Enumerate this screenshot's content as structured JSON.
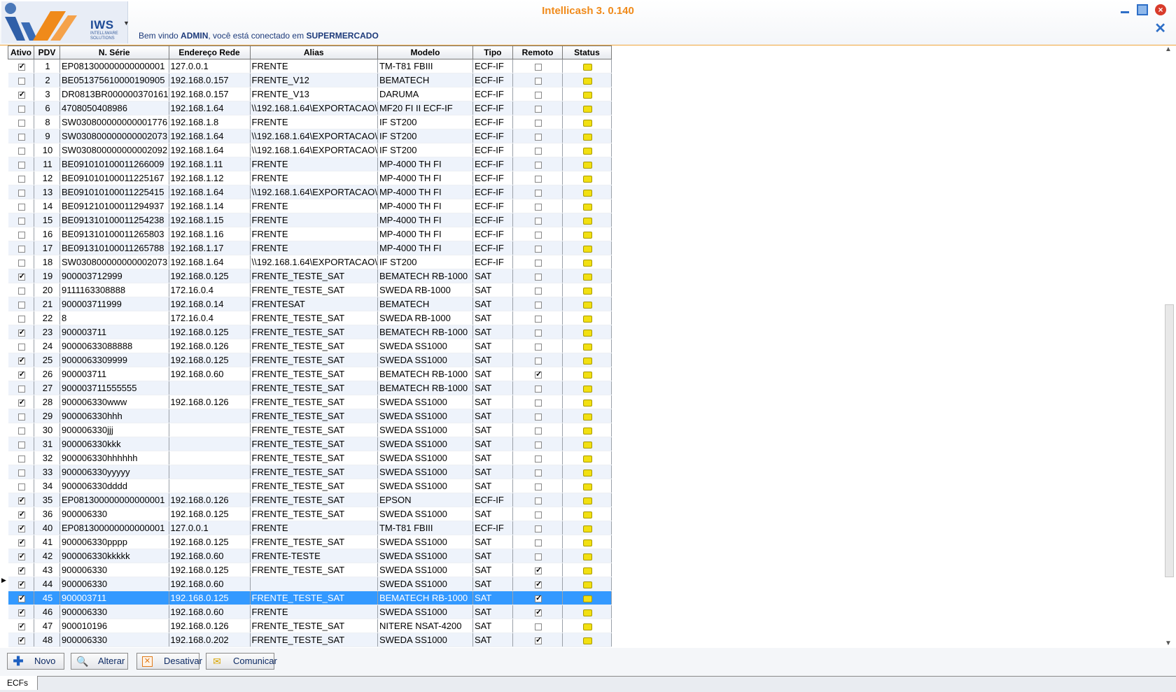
{
  "app": {
    "title": "Intellicash 3. 0.140",
    "logo_text": "IWS",
    "logo_sub": "INTELLIWARE SOLUTIONS",
    "welcome_prefix": "Bem vindo ",
    "user": "ADMIN",
    "welcome_mid": ", você está conectado em ",
    "store": "SUPERMERCADO"
  },
  "grid": {
    "columns": [
      "Ativo",
      "PDV",
      "N. Série",
      "Endereço Rede",
      "Alias",
      "Modelo",
      "Tipo",
      "Remoto",
      "Status"
    ],
    "rows": [
      {
        "ativo": true,
        "pdv": "1",
        "serie": "EP081300000000000001",
        "ip": "127.0.0.1",
        "alias": "FRENTE",
        "modelo": "TM-T81 FBIII",
        "tipo": "ECF-IF",
        "remoto": false
      },
      {
        "ativo": false,
        "pdv": "2",
        "serie": "BE051375610000190905",
        "ip": "192.168.0.157",
        "alias": "FRENTE_V12",
        "modelo": "BEMATECH",
        "tipo": "ECF-IF",
        "remoto": false
      },
      {
        "ativo": true,
        "pdv": "3",
        "serie": "DR0813BR000000370161",
        "ip": "192.168.0.157",
        "alias": "FRENTE_V13",
        "modelo": "DARUMA",
        "tipo": "ECF-IF",
        "remoto": false
      },
      {
        "ativo": false,
        "pdv": "6",
        "serie": "4708050408986",
        "ip": "192.168.1.64",
        "alias": "\\\\192.168.1.64\\EXPORTACAO\\",
        "modelo": "MF20 FI II ECF-IF",
        "tipo": "ECF-IF",
        "remoto": false
      },
      {
        "ativo": false,
        "pdv": "8",
        "serie": "SW030800000000001776",
        "ip": "192.168.1.8",
        "alias": "FRENTE",
        "modelo": "IF ST200",
        "tipo": "ECF-IF",
        "remoto": false
      },
      {
        "ativo": false,
        "pdv": "9",
        "serie": "SW030800000000002073",
        "ip": "192.168.1.64",
        "alias": "\\\\192.168.1.64\\EXPORTACAO\\",
        "modelo": "IF ST200",
        "tipo": "ECF-IF",
        "remoto": false
      },
      {
        "ativo": false,
        "pdv": "10",
        "serie": "SW030800000000002092",
        "ip": "192.168.1.64",
        "alias": "\\\\192.168.1.64\\EXPORTACAO\\",
        "modelo": "IF ST200",
        "tipo": "ECF-IF",
        "remoto": false
      },
      {
        "ativo": false,
        "pdv": "11",
        "serie": "BE091010100011266009",
        "ip": "192.168.1.11",
        "alias": "FRENTE",
        "modelo": "MP-4000 TH FI",
        "tipo": "ECF-IF",
        "remoto": false
      },
      {
        "ativo": false,
        "pdv": "12",
        "serie": "BE091010100011225167",
        "ip": "192.168.1.12",
        "alias": "FRENTE",
        "modelo": "MP-4000 TH FI",
        "tipo": "ECF-IF",
        "remoto": false
      },
      {
        "ativo": false,
        "pdv": "13",
        "serie": "BE091010100011225415",
        "ip": "192.168.1.64",
        "alias": "\\\\192.168.1.64\\EXPORTACAO\\",
        "modelo": "MP-4000 TH FI",
        "tipo": "ECF-IF",
        "remoto": false
      },
      {
        "ativo": false,
        "pdv": "14",
        "serie": "BE091210100011294937",
        "ip": "192.168.1.14",
        "alias": "FRENTE",
        "modelo": "MP-4000 TH FI",
        "tipo": "ECF-IF",
        "remoto": false
      },
      {
        "ativo": false,
        "pdv": "15",
        "serie": "BE091310100011254238",
        "ip": "192.168.1.15",
        "alias": "FRENTE",
        "modelo": "MP-4000 TH FI",
        "tipo": "ECF-IF",
        "remoto": false
      },
      {
        "ativo": false,
        "pdv": "16",
        "serie": "BE091310100011265803",
        "ip": "192.168.1.16",
        "alias": "FRENTE",
        "modelo": "MP-4000 TH FI",
        "tipo": "ECF-IF",
        "remoto": false
      },
      {
        "ativo": false,
        "pdv": "17",
        "serie": "BE091310100011265788",
        "ip": "192.168.1.17",
        "alias": "FRENTE",
        "modelo": "MP-4000 TH FI",
        "tipo": "ECF-IF",
        "remoto": false
      },
      {
        "ativo": false,
        "pdv": "18",
        "serie": "SW030800000000002073",
        "ip": "192.168.1.64",
        "alias": "\\\\192.168.1.64\\EXPORTACAO\\",
        "modelo": "IF ST200",
        "tipo": "ECF-IF",
        "remoto": false
      },
      {
        "ativo": true,
        "pdv": "19",
        "serie": "900003712999",
        "ip": "192.168.0.125",
        "alias": "FRENTE_TESTE_SAT",
        "modelo": "BEMATECH RB-1000",
        "tipo": "SAT",
        "remoto": false
      },
      {
        "ativo": false,
        "pdv": "20",
        "serie": "9111163308888",
        "ip": "172.16.0.4",
        "alias": "FRENTE_TESTE_SAT",
        "modelo": "SWEDA RB-1000",
        "tipo": "SAT",
        "remoto": false
      },
      {
        "ativo": false,
        "pdv": "21",
        "serie": "900003711999",
        "ip": "192.168.0.14",
        "alias": "FRENTESAT",
        "modelo": "BEMATECH",
        "tipo": "SAT",
        "remoto": false
      },
      {
        "ativo": false,
        "pdv": "22",
        "serie": "8",
        "ip": "172.16.0.4",
        "alias": "FRENTE_TESTE_SAT",
        "modelo": "SWEDA RB-1000",
        "tipo": "SAT",
        "remoto": false
      },
      {
        "ativo": true,
        "pdv": "23",
        "serie": "900003711",
        "ip": "192.168.0.125",
        "alias": "FRENTE_TESTE_SAT",
        "modelo": "BEMATECH RB-1000",
        "tipo": "SAT",
        "remoto": false
      },
      {
        "ativo": false,
        "pdv": "24",
        "serie": "90000633088888",
        "ip": "192.168.0.126",
        "alias": "FRENTE_TESTE_SAT",
        "modelo": "SWEDA SS1000",
        "tipo": "SAT",
        "remoto": false
      },
      {
        "ativo": true,
        "pdv": "25",
        "serie": "9000063309999",
        "ip": "192.168.0.125",
        "alias": "FRENTE_TESTE_SAT",
        "modelo": "SWEDA SS1000",
        "tipo": "SAT",
        "remoto": false
      },
      {
        "ativo": true,
        "pdv": "26",
        "serie": "900003711",
        "ip": "192.168.0.60",
        "alias": "FRENTE_TESTE_SAT",
        "modelo": "BEMATECH RB-1000",
        "tipo": "SAT",
        "remoto": true
      },
      {
        "ativo": false,
        "pdv": "27",
        "serie": "900003711555555",
        "ip": "",
        "alias": "FRENTE_TESTE_SAT",
        "modelo": "BEMATECH RB-1000",
        "tipo": "SAT",
        "remoto": false
      },
      {
        "ativo": true,
        "pdv": "28",
        "serie": "900006330www",
        "ip": "192.168.0.126",
        "alias": "FRENTE_TESTE_SAT",
        "modelo": "SWEDA SS1000",
        "tipo": "SAT",
        "remoto": false
      },
      {
        "ativo": false,
        "pdv": "29",
        "serie": "900006330hhh",
        "ip": "",
        "alias": "FRENTE_TESTE_SAT",
        "modelo": "SWEDA SS1000",
        "tipo": "SAT",
        "remoto": false
      },
      {
        "ativo": false,
        "pdv": "30",
        "serie": "900006330jjj",
        "ip": "",
        "alias": "FRENTE_TESTE_SAT",
        "modelo": "SWEDA SS1000",
        "tipo": "SAT",
        "remoto": false
      },
      {
        "ativo": false,
        "pdv": "31",
        "serie": "900006330kkk",
        "ip": "",
        "alias": "FRENTE_TESTE_SAT",
        "modelo": "SWEDA SS1000",
        "tipo": "SAT",
        "remoto": false
      },
      {
        "ativo": false,
        "pdv": "32",
        "serie": "900006330hhhhhh",
        "ip": "",
        "alias": "FRENTE_TESTE_SAT",
        "modelo": "SWEDA SS1000",
        "tipo": "SAT",
        "remoto": false
      },
      {
        "ativo": false,
        "pdv": "33",
        "serie": "900006330yyyyy",
        "ip": "",
        "alias": "FRENTE_TESTE_SAT",
        "modelo": "SWEDA SS1000",
        "tipo": "SAT",
        "remoto": false
      },
      {
        "ativo": false,
        "pdv": "34",
        "serie": "900006330dddd",
        "ip": "",
        "alias": "FRENTE_TESTE_SAT",
        "modelo": "SWEDA SS1000",
        "tipo": "SAT",
        "remoto": false
      },
      {
        "ativo": true,
        "pdv": "35",
        "serie": "EP081300000000000001",
        "ip": "192.168.0.126",
        "alias": "FRENTE_TESTE_SAT",
        "modelo": "EPSON",
        "tipo": "ECF-IF",
        "remoto": false
      },
      {
        "ativo": true,
        "pdv": "36",
        "serie": "900006330",
        "ip": "192.168.0.125",
        "alias": "FRENTE_TESTE_SAT",
        "modelo": "SWEDA SS1000",
        "tipo": "SAT",
        "remoto": false
      },
      {
        "ativo": true,
        "pdv": "40",
        "serie": "EP081300000000000001",
        "ip": "127.0.0.1",
        "alias": "FRENTE",
        "modelo": "TM-T81 FBIII",
        "tipo": "ECF-IF",
        "remoto": false
      },
      {
        "ativo": true,
        "pdv": "41",
        "serie": "900006330pppp",
        "ip": " 192.168.0.125",
        "alias": "FRENTE_TESTE_SAT",
        "modelo": "SWEDA SS1000",
        "tipo": "SAT",
        "remoto": false
      },
      {
        "ativo": true,
        "pdv": "42",
        "serie": "900006330kkkkk",
        "ip": "192.168.0.60",
        "alias": "FRENTE-TESTE",
        "modelo": "SWEDA SS1000",
        "tipo": "SAT",
        "remoto": false
      },
      {
        "ativo": true,
        "pdv": "43",
        "serie": "900006330",
        "ip": "192.168.0.125",
        "alias": "FRENTE_TESTE_SAT",
        "modelo": "SWEDA SS1000",
        "tipo": "SAT",
        "remoto": true
      },
      {
        "ativo": true,
        "pdv": "44",
        "serie": "900006330",
        "ip": "192.168.0.60",
        "alias": "",
        "modelo": "SWEDA SS1000",
        "tipo": "SAT",
        "remoto": true
      },
      {
        "ativo": true,
        "pdv": "45",
        "serie": "900003711",
        "ip": " 192.168.0.125",
        "alias": "FRENTE_TESTE_SAT",
        "modelo": "BEMATECH RB-1000",
        "tipo": "SAT",
        "remoto": true,
        "selected": true
      },
      {
        "ativo": true,
        "pdv": "46",
        "serie": "900006330",
        "ip": "192.168.0.60",
        "alias": "FRENTE",
        "modelo": "SWEDA SS1000",
        "tipo": "SAT",
        "remoto": true
      },
      {
        "ativo": true,
        "pdv": "47",
        "serie": "900010196",
        "ip": " 192.168.0.126",
        "alias": "FRENTE_TESTE_SAT",
        "modelo": "NITERE NSAT-4200",
        "tipo": "SAT",
        "remoto": false
      },
      {
        "ativo": true,
        "pdv": "48",
        "serie": "900006330",
        "ip": "192.168.0.202",
        "alias": "FRENTE_TESTE_SAT",
        "modelo": "SWEDA SS1000",
        "tipo": "SAT",
        "remoto": true
      }
    ]
  },
  "toolbar": {
    "novo": "Novo",
    "alterar": "Alterar",
    "desativar": "Desativar",
    "comunicar": "Comunicar"
  },
  "tabs": {
    "active": "ECFs"
  },
  "colors": {
    "accent": "#f08a1a",
    "selection": "#3399ff",
    "status": "#f2e012",
    "text_blue": "#1d3a7a"
  }
}
